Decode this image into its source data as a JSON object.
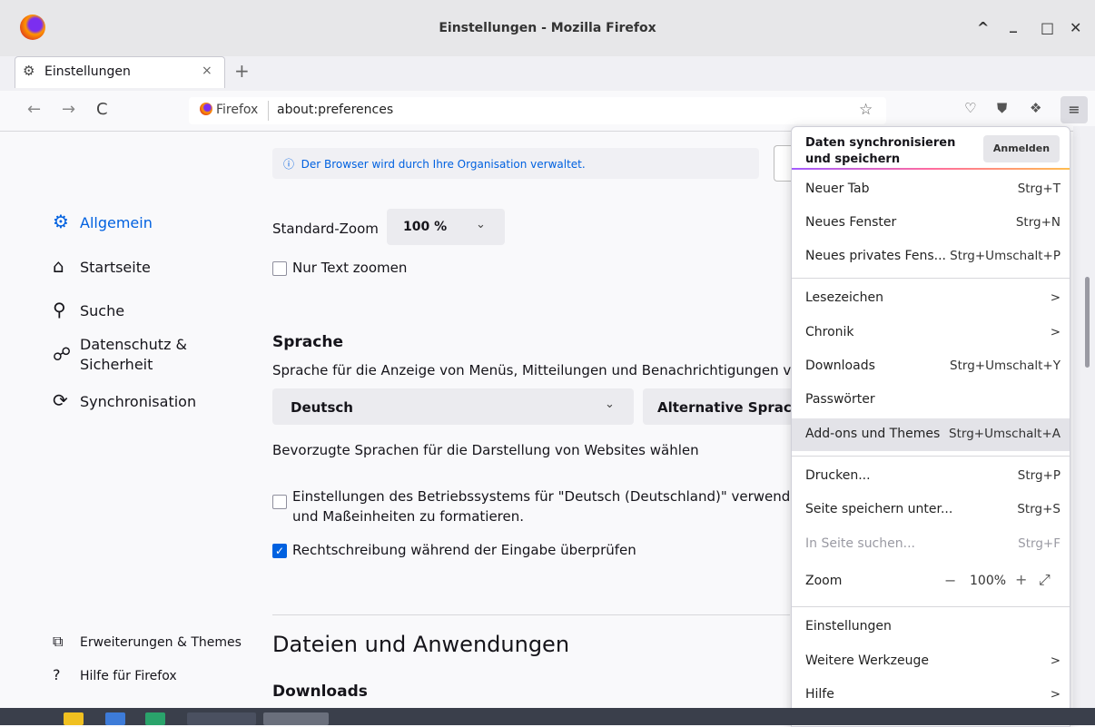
{
  "window": {
    "title": "Einstellungen - Mozilla Firefox",
    "controls": [
      "^",
      "_",
      "□",
      "✕"
    ]
  },
  "tab": {
    "label": "Einstellungen",
    "close": "×",
    "new_tab": "+"
  },
  "nav": {
    "back": "←",
    "forward": "→",
    "reload": "C"
  },
  "urlbar": {
    "brand": "Firefox",
    "url": "about:preferences",
    "star": "☆"
  },
  "toolbar": {
    "pocket": "♡",
    "ublock": "⛊",
    "ext": "❖",
    "menu": "≡"
  },
  "sidebar": {
    "items": [
      {
        "label": "Allgemein",
        "icon": "gear-icon",
        "glyph": "⚙"
      },
      {
        "label": "Startseite",
        "icon": "home-icon",
        "glyph": "⌂"
      },
      {
        "label": "Suche",
        "icon": "search-icon",
        "glyph": "⚲"
      },
      {
        "label": "Datenschutz &",
        "label2": "Sicherheit",
        "icon": "lock-icon",
        "glyph": "🔒︎"
      },
      {
        "label": "Synchronisation",
        "icon": "sync-icon",
        "glyph": "⟳"
      }
    ],
    "footer": [
      {
        "label": "Erweiterungen & Themes",
        "icon": "puzzle-icon",
        "glyph": "⧉"
      },
      {
        "label": "Hilfe für Firefox",
        "icon": "help-icon",
        "glyph": "?"
      }
    ]
  },
  "main": {
    "banner": "Der Browser wird durch Ihre Organisation verwaltet.",
    "zoom_label": "Standard-Zoom",
    "zoom_value": "100 %",
    "text_zoom": "Nur Text zoomen",
    "lang_heading": "Sprache",
    "lang_desc": "Sprache für die Anzeige von Menüs, Mitteilungen und Benachrichtigungen v",
    "lang_value": "Deutsch",
    "alt_button": "Alternative Sprach",
    "pref_lang": "Bevorzugte Sprachen für die Darstellung von Websites wählen",
    "os_settings_1": "Einstellungen des Betriebssystems für \"Deutsch (Deutschland)\" verwende",
    "os_settings_2": "und Maßeinheiten zu formatieren.",
    "spellcheck": "Rechtschreibung während der Eingabe überprüfen",
    "files_heading": "Dateien und Anwendungen",
    "downloads_heading": "Downloads"
  },
  "appmenu": {
    "sync_title_1": "Daten synchronisieren",
    "sync_title_2": "und speichern",
    "signin": "Anmelden",
    "items": [
      {
        "label": "Neuer Tab",
        "shortcut": "Strg+T"
      },
      {
        "label": "Neues Fenster",
        "shortcut": "Strg+N"
      },
      {
        "label": "Neues privates Fens...",
        "shortcut": "Strg+Umschalt+P"
      },
      {
        "label": "Lesezeichen",
        "shortcut": ">"
      },
      {
        "label": "Chronik",
        "shortcut": ">"
      },
      {
        "label": "Downloads",
        "shortcut": "Strg+Umschalt+Y"
      },
      {
        "label": "Passwörter",
        "shortcut": ""
      },
      {
        "label": "Add-ons und Themes",
        "shortcut": "Strg+Umschalt+A"
      },
      {
        "label": "Drucken...",
        "shortcut": "Strg+P"
      },
      {
        "label": "Seite speichern unter...",
        "shortcut": "Strg+S"
      },
      {
        "label": "In Seite suchen...",
        "shortcut": "Strg+F"
      },
      {
        "label": "Zoom",
        "shortcut": ""
      },
      {
        "label": "Einstellungen",
        "shortcut": ""
      },
      {
        "label": "Weitere Werkzeuge",
        "shortcut": ">"
      },
      {
        "label": "Hilfe",
        "shortcut": ">"
      }
    ],
    "zoom_minus": "−",
    "zoom_value": "100%",
    "zoom_plus": "+",
    "zoom_full": "⤢"
  }
}
